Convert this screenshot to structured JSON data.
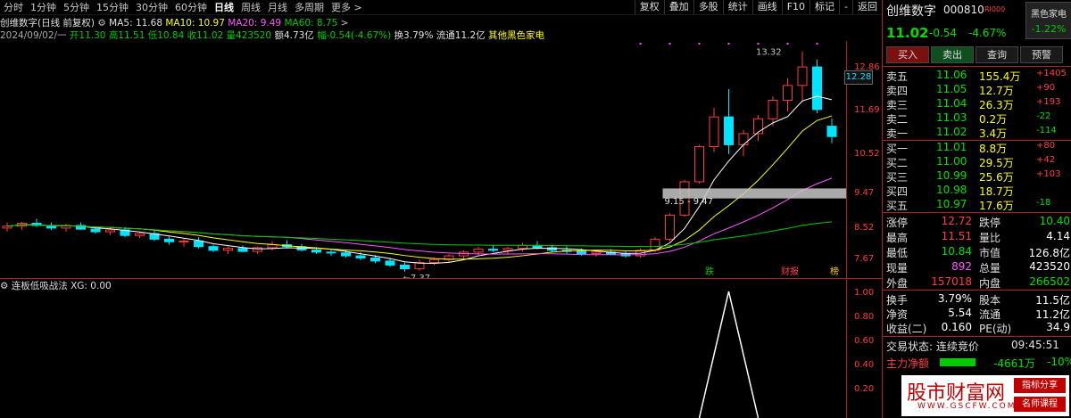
{
  "toolbar": {
    "periods": [
      "分时",
      "1分钟",
      "5分钟",
      "15分钟",
      "30分钟",
      "60分钟",
      "日线",
      "周线",
      "月线",
      "多周期",
      "更多 >"
    ],
    "active_period": "日线",
    "tools": [
      "复权",
      "叠加",
      "多股",
      "统计",
      "画线",
      "F10",
      "标记",
      "-",
      "返回"
    ]
  },
  "info": {
    "title": "创维数字(日线 前复权)",
    "ma5": "MA5: 11.68",
    "ma10": "MA10: 10.97",
    "ma20": "MA20: 9.49",
    "ma60": "MA60: 8.75",
    "date": "2024/09/02/一",
    "open": "开11.30",
    "high": "高11.51",
    "low": "低10.84",
    "close": "收11.02",
    "vol": "量423520",
    "amount": "额4.73亿",
    "change": "幅-0.54(-4.67%)",
    "turnover": "换3.79%",
    "float": "流通11.2亿",
    "sector": "其他黑色家电"
  },
  "price_axis": [
    "12.86",
    "11.69",
    "10.52",
    "9.47",
    "8.52",
    "7.67"
  ],
  "current_price_tag": "12.28",
  "annotations": {
    "high": "13.32",
    "low": "7.37",
    "range": "9.15 - 9.47",
    "marks": [
      "跌",
      "财报",
      "榜"
    ]
  },
  "indicator": {
    "label": "连板低吸战法  XG: 0.00",
    "axis": [
      "1.00",
      "0.80",
      "0.60",
      "0.40",
      "0.20"
    ]
  },
  "panel": {
    "name": "创维数字",
    "code": "000810",
    "tag": "RI000",
    "sector_tag": "黑色家电",
    "sector_change": "-1.22%",
    "price": "11.02",
    "change": "-0.54",
    "pct": "-4.67%",
    "buttons": [
      "买入",
      "卖出",
      "查询",
      "预警"
    ],
    "sells": [
      {
        "label": "卖五",
        "price": "11.06",
        "vol": "155.4万",
        "delta": "+1405"
      },
      {
        "label": "卖四",
        "price": "11.05",
        "vol": "12.7万",
        "delta": "+90"
      },
      {
        "label": "卖三",
        "price": "11.04",
        "vol": "26.3万",
        "delta": "+193"
      },
      {
        "label": "卖二",
        "price": "11.03",
        "vol": "0.2万",
        "delta": "-22"
      },
      {
        "label": "卖一",
        "price": "11.02",
        "vol": "3.4万",
        "delta": "-114"
      }
    ],
    "buys": [
      {
        "label": "买一",
        "price": "11.01",
        "vol": "8.8万",
        "delta": "+80"
      },
      {
        "label": "买二",
        "price": "11.00",
        "vol": "29.5万",
        "delta": "+42"
      },
      {
        "label": "买三",
        "price": "10.99",
        "vol": "25.6万",
        "delta": "+103"
      },
      {
        "label": "买四",
        "price": "10.98",
        "vol": "18.7万",
        "delta": ""
      },
      {
        "label": "买五",
        "price": "10.97",
        "vol": "17.6万",
        "delta": "-18"
      }
    ],
    "stats": [
      [
        "涨停",
        "12.72",
        "跌停",
        "10.40"
      ],
      [
        "最高",
        "11.51",
        "量比",
        "4.14"
      ],
      [
        "最低",
        "10.84",
        "市值",
        "126.8亿"
      ],
      [
        "现量",
        "892",
        "总量",
        "423520"
      ],
      [
        "外盘",
        "157018",
        "内盘",
        "266502"
      ]
    ],
    "stats2": [
      [
        "换手",
        "3.79%",
        "股本",
        "11.5亿"
      ],
      [
        "净资",
        "5.54",
        "流通",
        "11.2亿"
      ],
      [
        "收益(二)",
        "0.160",
        "PE(动)",
        "34.9"
      ]
    ],
    "status_label": "交易状态: 连续竞价",
    "status_time": "09:45:51",
    "mainflow_label": "主力净额",
    "mainflow_value": "-4661万",
    "mainflow_pct": "-10%"
  },
  "watermark": {
    "title": "股市财富网",
    "url": "WWW.GSCFW.COM",
    "tag1": "指标分享",
    "tag2": "名师课程"
  },
  "chart_data": {
    "type": "candlestick",
    "candles": [
      [
        8.55,
        8.7,
        8.45,
        8.6
      ],
      [
        8.6,
        8.72,
        8.5,
        8.68
      ],
      [
        8.68,
        8.8,
        8.58,
        8.62
      ],
      [
        8.62,
        8.7,
        8.5,
        8.55
      ],
      [
        8.55,
        8.66,
        8.45,
        8.62
      ],
      [
        8.62,
        8.7,
        8.5,
        8.52
      ],
      [
        8.52,
        8.6,
        8.4,
        8.45
      ],
      [
        8.45,
        8.55,
        8.36,
        8.5
      ],
      [
        8.5,
        8.58,
        8.3,
        8.35
      ],
      [
        8.35,
        8.45,
        8.28,
        8.4
      ],
      [
        8.4,
        8.5,
        8.2,
        8.25
      ],
      [
        8.25,
        8.32,
        8.1,
        8.18
      ],
      [
        8.18,
        8.26,
        8.05,
        8.2
      ],
      [
        8.2,
        8.3,
        8.0,
        8.05
      ],
      [
        8.05,
        8.1,
        7.9,
        7.95
      ],
      [
        7.95,
        8.05,
        7.85,
        8.0
      ],
      [
        8.0,
        8.08,
        7.9,
        7.92
      ],
      [
        7.92,
        8.05,
        7.85,
        8.02
      ],
      [
        8.02,
        8.2,
        7.95,
        8.1
      ],
      [
        8.1,
        8.22,
        8.0,
        8.05
      ],
      [
        8.05,
        8.12,
        7.92,
        7.96
      ],
      [
        7.96,
        8.04,
        7.85,
        7.9
      ],
      [
        7.9,
        7.98,
        7.8,
        7.88
      ],
      [
        7.88,
        7.96,
        7.75,
        7.8
      ],
      [
        7.8,
        7.9,
        7.68,
        7.74
      ],
      [
        7.74,
        7.82,
        7.6,
        7.66
      ],
      [
        7.66,
        7.74,
        7.5,
        7.55
      ],
      [
        7.55,
        7.62,
        7.37,
        7.45
      ],
      [
        7.45,
        7.7,
        7.4,
        7.62
      ],
      [
        7.62,
        7.75,
        7.55,
        7.7
      ],
      [
        7.7,
        7.85,
        7.62,
        7.8
      ],
      [
        7.8,
        7.95,
        7.72,
        7.9
      ],
      [
        7.9,
        8.05,
        7.82,
        7.98
      ],
      [
        7.98,
        8.1,
        7.9,
        7.95
      ],
      [
        7.95,
        8.05,
        7.85,
        8.0
      ],
      [
        8.0,
        8.15,
        7.92,
        8.08
      ],
      [
        8.08,
        8.2,
        7.98,
        8.02
      ],
      [
        8.02,
        8.1,
        7.9,
        7.95
      ],
      [
        7.95,
        8.05,
        7.85,
        7.92
      ],
      [
        7.92,
        8.0,
        7.8,
        7.86
      ],
      [
        7.86,
        7.95,
        7.78,
        7.9
      ],
      [
        7.9,
        7.98,
        7.82,
        7.85
      ],
      [
        7.85,
        7.95,
        7.75,
        7.8
      ],
      [
        7.8,
        8.0,
        7.75,
        7.95
      ],
      [
        7.95,
        8.3,
        7.9,
        8.25
      ],
      [
        8.25,
        8.95,
        8.2,
        8.9
      ],
      [
        8.9,
        9.85,
        8.85,
        9.8
      ],
      [
        9.8,
        10.8,
        9.75,
        10.75
      ],
      [
        10.75,
        11.8,
        10.6,
        11.55
      ],
      [
        11.55,
        12.3,
        10.55,
        10.8
      ],
      [
        10.8,
        11.2,
        10.5,
        11.1
      ],
      [
        11.1,
        11.6,
        10.9,
        11.5
      ],
      [
        11.5,
        12.1,
        11.3,
        12.0
      ],
      [
        12.0,
        12.6,
        11.7,
        12.4
      ],
      [
        12.4,
        13.32,
        11.95,
        12.9
      ],
      [
        12.9,
        13.1,
        11.65,
        11.75
      ],
      [
        11.3,
        11.51,
        10.84,
        11.02
      ]
    ],
    "ma5": [
      11.68
    ],
    "ma10": [
      10.97
    ],
    "ma20": [
      9.49
    ],
    "ma60": [
      8.75
    ],
    "ylim": [
      7.2,
      13.6
    ]
  }
}
